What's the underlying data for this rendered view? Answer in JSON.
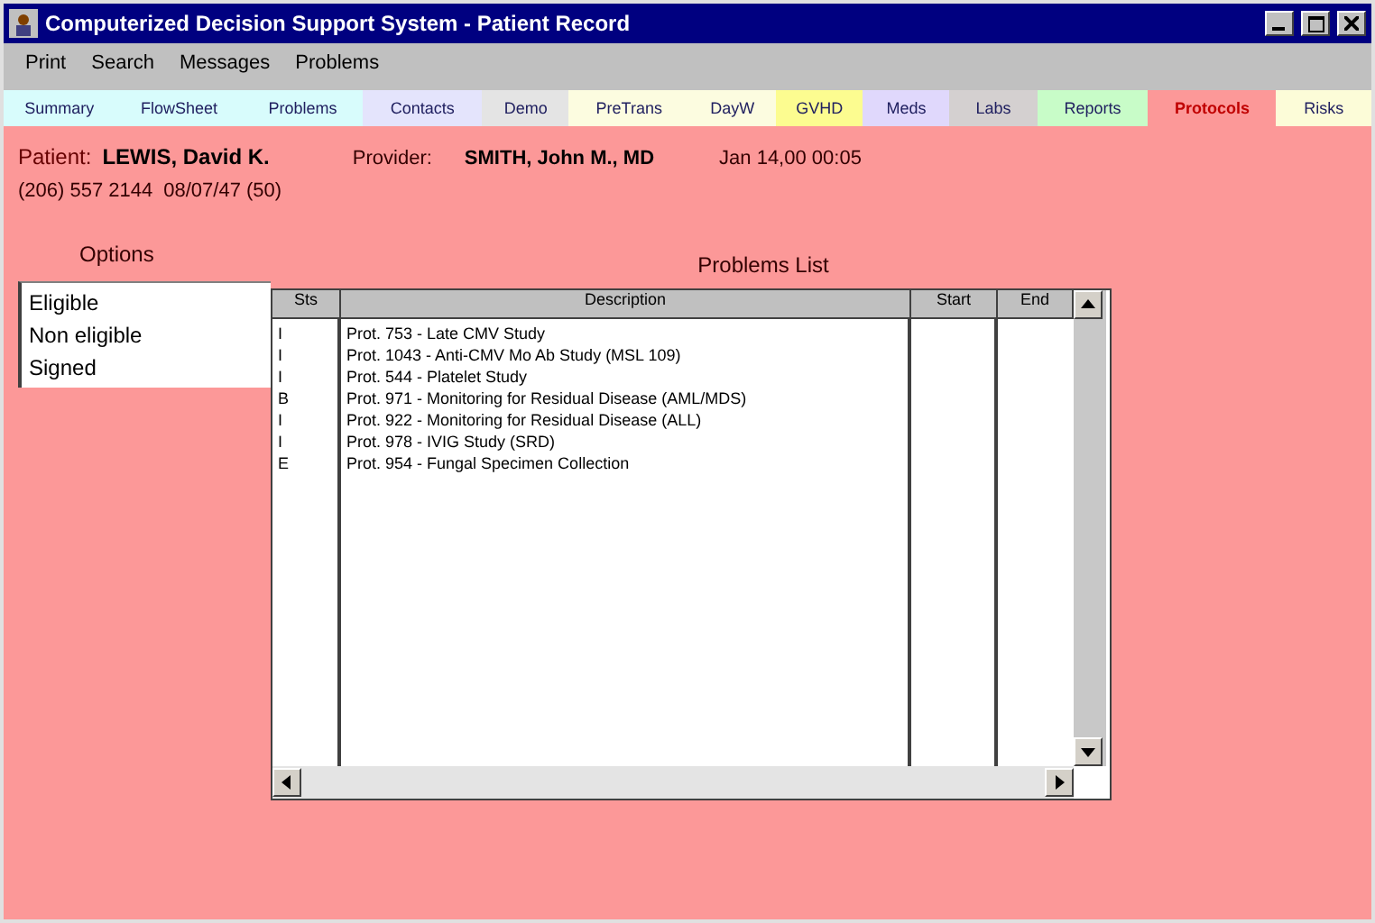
{
  "window": {
    "title": "Computerized Decision Support System - Patient Record"
  },
  "menu": [
    "Print",
    "Search",
    "Messages",
    "Problems"
  ],
  "tabs": [
    {
      "label": "Summary",
      "color": "#d8fcfc",
      "selected": false
    },
    {
      "label": "FlowSheet",
      "color": "#d8fcfc",
      "selected": false
    },
    {
      "label": "Problems",
      "color": "#d8fcfc",
      "selected": false
    },
    {
      "label": "Contacts",
      "color": "#e4e4fc",
      "selected": false
    },
    {
      "label": "Demo",
      "color": "#e4e4e4",
      "selected": false
    },
    {
      "label": "PreTrans",
      "color": "#fcfce0",
      "selected": false
    },
    {
      "label": "DayW",
      "color": "#fcfce0",
      "selected": false
    },
    {
      "label": "GVHD",
      "color": "#fcfc90",
      "selected": false
    },
    {
      "label": "Meds",
      "color": "#e0d8fc",
      "selected": false
    },
    {
      "label": "Labs",
      "color": "#d4d0d0",
      "selected": false
    },
    {
      "label": "Reports",
      "color": "#c8fcc8",
      "selected": false
    },
    {
      "label": "Protocols",
      "color": "#fc9898",
      "selected": true
    },
    {
      "label": "Risks",
      "color": "#fcfcd8",
      "selected": false
    }
  ],
  "patient": {
    "label": "Patient:",
    "name": "LEWIS, David K.",
    "provider_label": "Provider:",
    "provider": "SMITH, John M., MD",
    "date": "Jan 14,00 00:05",
    "phone": "(206) 557 2144",
    "dob": "08/07/47 (50)"
  },
  "options": {
    "title": "Options",
    "items": [
      "Eligible",
      "Non eligible",
      "Signed"
    ]
  },
  "problems": {
    "title": "Problems List",
    "columns": [
      "Sts",
      "Description",
      "Start",
      "End"
    ],
    "rows": [
      {
        "status": "I",
        "description": "Prot. 753 - Late CMV Study"
      },
      {
        "status": "I",
        "description": "Prot. 1043 - Anti-CMV Mo Ab Study (MSL 109)"
      },
      {
        "status": "I",
        "description": "Prot. 544 - Platelet Study"
      },
      {
        "status": "B",
        "description": "Prot. 971 - Monitoring for Residual Disease (AML/MDS)"
      },
      {
        "status": "I",
        "description": "Prot. 922 - Monitoring for Residual Disease (ALL)"
      },
      {
        "status": "I",
        "description": "Prot. 978 - IVIG Study (SRD)"
      },
      {
        "status": "E",
        "description": "Prot. 954 - Fungal Specimen Collection"
      }
    ]
  }
}
